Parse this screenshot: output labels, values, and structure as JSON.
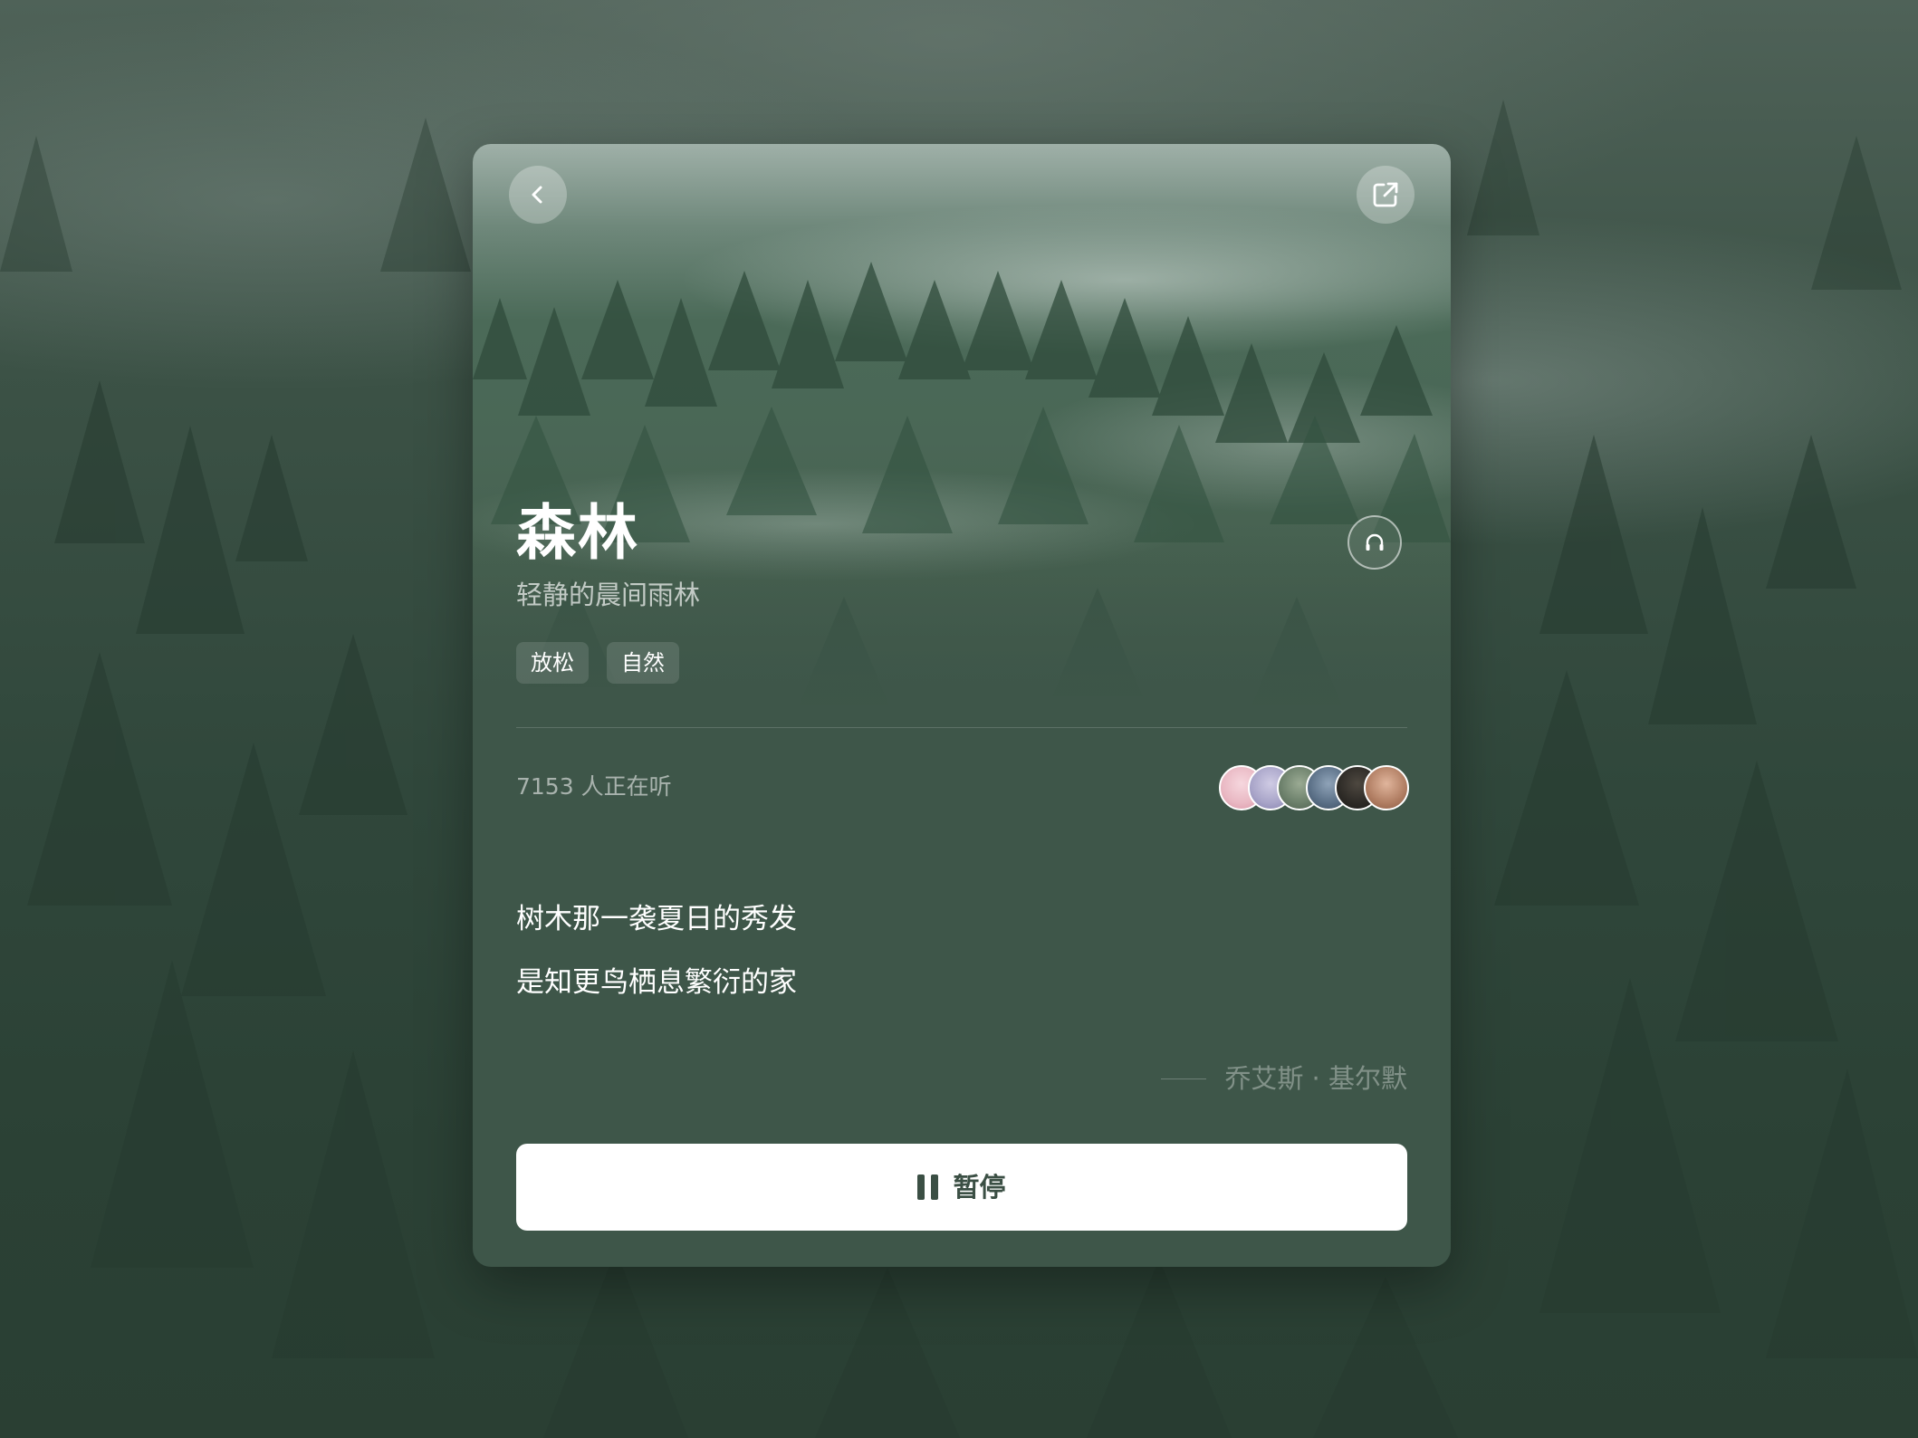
{
  "header": {
    "back_icon": "chevron-left-icon",
    "share_icon": "share-external-icon"
  },
  "scene": {
    "title": "森林",
    "subtitle": "轻静的晨间雨林",
    "listen_icon": "headphones-icon",
    "tags": [
      "放松",
      "自然"
    ]
  },
  "listeners": {
    "text": "7153 人正在听",
    "avatar_colors": [
      "#e9b8c3",
      "#a8a4c8",
      "#6b7f6a",
      "#5a6f86",
      "#2d2a26",
      "#b07d62"
    ]
  },
  "quote": {
    "lines": [
      "树木那一袭夏日的秀发",
      "是知更鸟栖息繁衍的家"
    ],
    "author": "乔艾斯 · 基尔默"
  },
  "player": {
    "pause_label": "暂停",
    "pause_icon": "pause-icon"
  },
  "colors": {
    "card_bg": "#3e5649",
    "accent_text": "#3b4f44"
  }
}
